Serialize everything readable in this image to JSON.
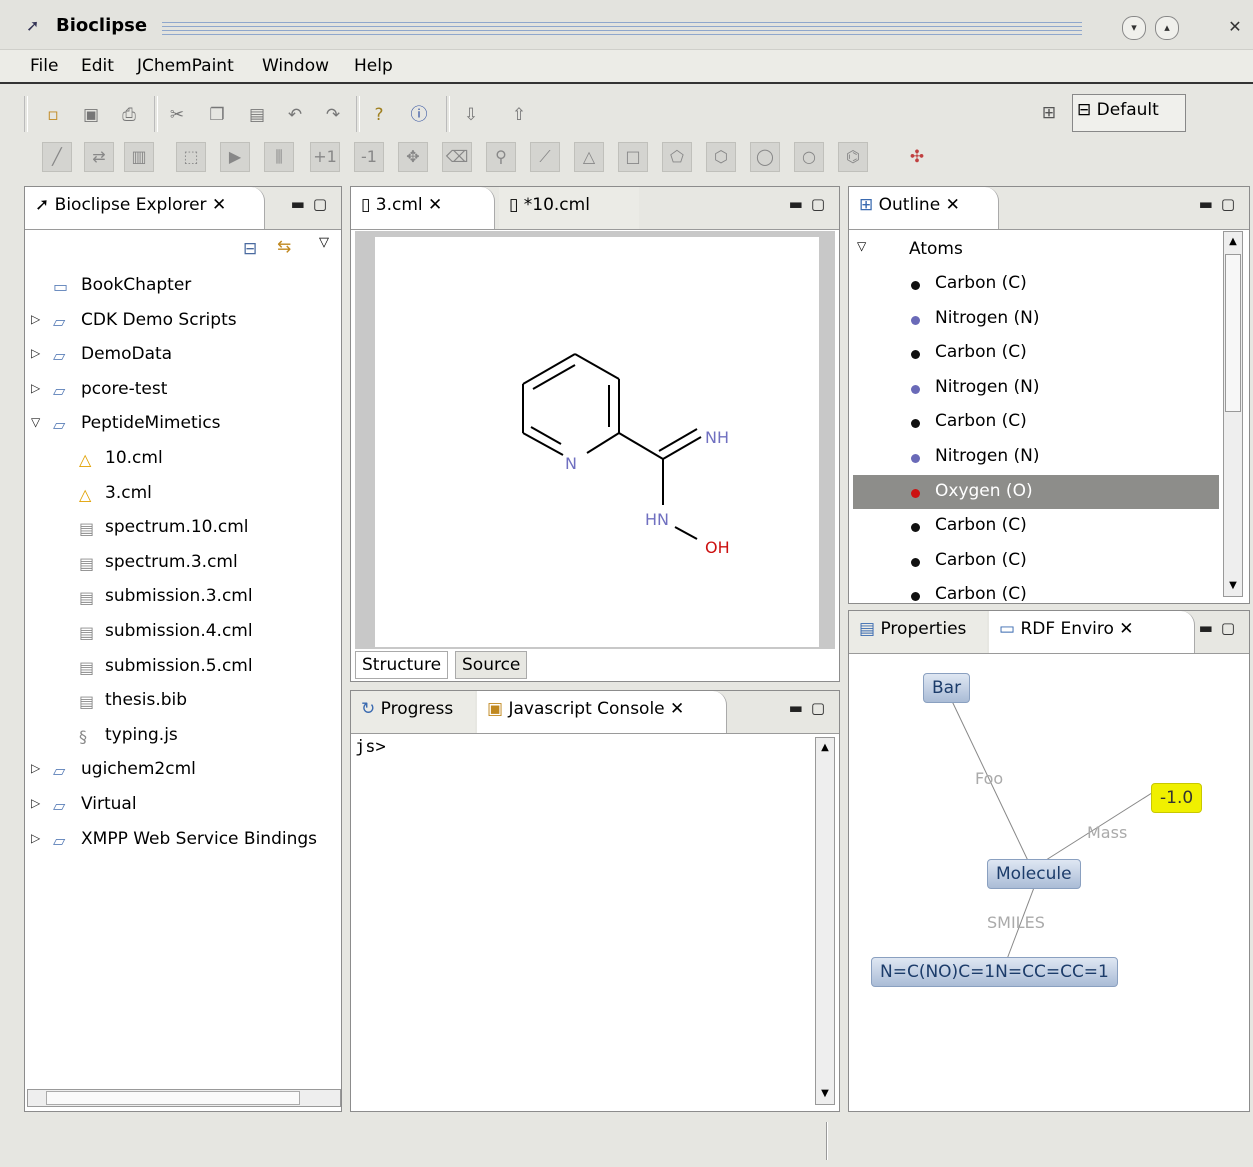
{
  "window": {
    "title": "Bioclipse"
  },
  "menu": [
    "File",
    "Edit",
    "JChemPaint",
    "Window",
    "Help"
  ],
  "perspective": {
    "label": "Default"
  },
  "explorer": {
    "tab": "Bioclipse Explorer",
    "items": [
      {
        "label": "BookChapter",
        "icon": "folder-icon",
        "expander": ""
      },
      {
        "label": "CDK Demo Scripts",
        "icon": "folder-open-icon",
        "expander": "▷"
      },
      {
        "label": "DemoData",
        "icon": "folder-open-icon",
        "expander": "▷"
      },
      {
        "label": "pcore-test",
        "icon": "folder-open-icon",
        "expander": "▷"
      },
      {
        "label": "PeptideMimetics",
        "icon": "folder-open-icon",
        "expander": "▽"
      },
      {
        "label": "10.cml",
        "icon": "warning-icon",
        "expander": ""
      },
      {
        "label": "3.cml",
        "icon": "warning-icon",
        "expander": ""
      },
      {
        "label": "spectrum.10.cml",
        "icon": "file-icon",
        "expander": ""
      },
      {
        "label": "spectrum.3.cml",
        "icon": "file-icon",
        "expander": ""
      },
      {
        "label": "submission.3.cml",
        "icon": "file-icon",
        "expander": ""
      },
      {
        "label": "submission.4.cml",
        "icon": "file-icon",
        "expander": ""
      },
      {
        "label": "submission.5.cml",
        "icon": "file-icon",
        "expander": ""
      },
      {
        "label": "thesis.bib",
        "icon": "file-icon",
        "expander": ""
      },
      {
        "label": "typing.js",
        "icon": "script-icon",
        "expander": ""
      },
      {
        "label": "ugichem2cml",
        "icon": "folder-open-icon",
        "expander": "▷"
      },
      {
        "label": "Virtual",
        "icon": "virtual-folder-icon",
        "expander": "▷"
      },
      {
        "label": "XMPP Web Service Bindings",
        "icon": "folder-open-icon",
        "expander": "▷"
      }
    ]
  },
  "editor": {
    "tabs": [
      "3.cml",
      "*10.cml"
    ],
    "bottom_tabs": [
      "Structure",
      "Source"
    ],
    "molecule_labels": {
      "n_ring": "N",
      "nh": "NH",
      "hn": "HN",
      "oh": "OH"
    }
  },
  "console": {
    "tabs": [
      "Progress",
      "Javascript Console"
    ],
    "prompt": "js>"
  },
  "outline": {
    "tab": "Outline",
    "root": "Atoms",
    "atoms": [
      {
        "label": "Carbon (C)",
        "color": "#111111",
        "selected": false
      },
      {
        "label": "Nitrogen (N)",
        "color": "#6a6ab8",
        "selected": false
      },
      {
        "label": "Carbon (C)",
        "color": "#111111",
        "selected": false
      },
      {
        "label": "Nitrogen (N)",
        "color": "#6a6ab8",
        "selected": false
      },
      {
        "label": "Carbon (C)",
        "color": "#111111",
        "selected": false
      },
      {
        "label": "Nitrogen (N)",
        "color": "#6a6ab8",
        "selected": false
      },
      {
        "label": "Oxygen (O)",
        "color": "#cc1111",
        "selected": true
      },
      {
        "label": "Carbon (C)",
        "color": "#111111",
        "selected": false
      },
      {
        "label": "Carbon (C)",
        "color": "#111111",
        "selected": false
      },
      {
        "label": "Carbon (C)",
        "color": "#111111",
        "selected": false
      }
    ]
  },
  "rdf": {
    "tabs": [
      "Properties",
      "RDF Enviro"
    ],
    "nodes": {
      "bar": "Bar",
      "value": "-1.0",
      "molecule": "Molecule",
      "smiles": "N=C(NO)C=1N=CC=CC=1"
    },
    "edges": {
      "foo": "Foo",
      "mass": "Mass",
      "smiles": "SMILES"
    }
  }
}
